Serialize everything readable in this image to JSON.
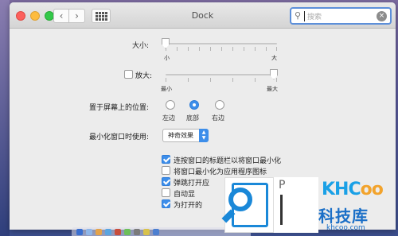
{
  "window": {
    "title": "Dock"
  },
  "toolbar": {
    "back_glyph": "‹",
    "forward_glyph": "›",
    "grid_icon": "show-all-grid-icon"
  },
  "search": {
    "placeholder": "搜索",
    "icon": "search-icon",
    "clear_icon": "clear-icon"
  },
  "size": {
    "label": "大小:",
    "min_label": "小",
    "max_label": "大",
    "value_fraction": 0.0
  },
  "magnification": {
    "label": "放大:",
    "checked": false,
    "min_label": "最小",
    "max_label": "最大",
    "value_fraction": 1.0
  },
  "position": {
    "label": "置于屏幕上的位置:",
    "options": [
      {
        "label": "左边",
        "selected": false
      },
      {
        "label": "底部",
        "selected": true
      },
      {
        "label": "右边",
        "selected": false
      }
    ]
  },
  "minimize": {
    "label": "最小化窗口时使用:",
    "value": "神奇效果"
  },
  "checkboxes": [
    {
      "label": "连按窗口的标题栏以将窗口最小化",
      "checked": true
    },
    {
      "label": "将窗口最小化为应用程序图标",
      "checked": false
    },
    {
      "label": "弹跳打开应",
      "checked": true
    },
    {
      "label": "自动显",
      "checked": false
    },
    {
      "label": "为打开的",
      "checked": true
    }
  ],
  "watermark": {
    "letter": "P",
    "logo_main": "KHC",
    "logo_accent": "oo",
    "brand": "科技库",
    "url": "khcoo.com"
  },
  "colors": {
    "accent": "#3d8eea",
    "close": "#fc605c",
    "minimize": "#fdbc40",
    "maximize": "#34c84a",
    "watermark_blue": "#1a88d8"
  }
}
